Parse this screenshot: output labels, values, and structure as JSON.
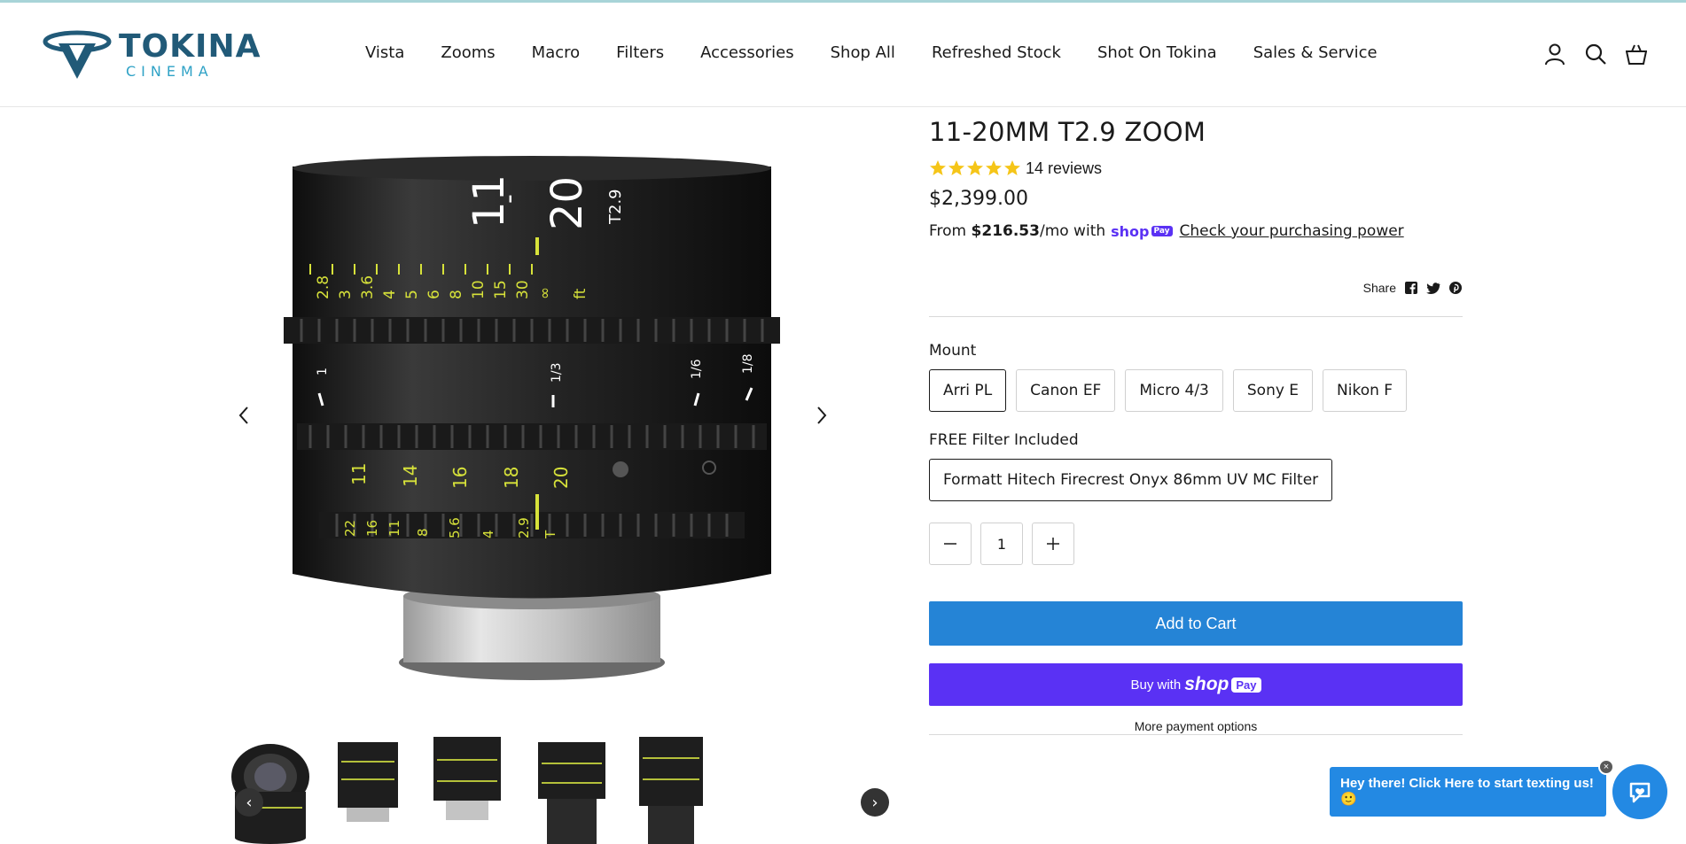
{
  "colors": {
    "brand_dark": "#215a78",
    "brand_light": "#2fa2c6",
    "add_to_cart": "#2584d6",
    "shop_pay": "#5a31f4",
    "chat": "#2389e3",
    "star": "#f5c518"
  },
  "brand": {
    "word": "TOKINA",
    "sub": "CINEMA"
  },
  "nav": {
    "items": [
      {
        "label": "Vista"
      },
      {
        "label": "Zooms"
      },
      {
        "label": "Macro"
      },
      {
        "label": "Filters"
      },
      {
        "label": "Accessories"
      },
      {
        "label": "Shop All"
      },
      {
        "label": "Refreshed Stock"
      },
      {
        "label": "Shot On Tokina"
      },
      {
        "label": "Sales & Service"
      }
    ]
  },
  "header_icons": [
    "account-icon",
    "search-icon",
    "cart-icon"
  ],
  "product": {
    "title": "11-20MM T2.9 ZOOM",
    "rating": 5,
    "reviews": "14 reviews",
    "price": "$2,399.00",
    "installment_prefix": "From",
    "installment_amount": "$216.53",
    "installment_suffix": "/mo with",
    "shop_pay_word": "shop",
    "shop_pay_badge": "Pay",
    "check_power": "Check your purchasing power",
    "share_label": "Share"
  },
  "lens_markings": {
    "focal_top": "11",
    "focal_bottom": "20",
    "aperture": "T2.9",
    "dash": "-",
    "distance": [
      "2.8",
      "3",
      "3.6",
      "4",
      "5",
      "6",
      "8",
      "10",
      "15",
      "30",
      "∞"
    ],
    "distance_unit": "ft",
    "zoom_scale": [
      "11",
      "14",
      "16",
      "18",
      "20"
    ],
    "iris_scale": [
      "22",
      "16",
      "11",
      "8",
      "5.6",
      "4",
      "2.9",
      "T"
    ],
    "fractions": [
      "1",
      "1/3",
      "1/6",
      "1/8"
    ]
  },
  "options": {
    "mount_label": "Mount",
    "mounts": [
      "Arri PL",
      "Canon EF",
      "Micro 4/3",
      "Sony E",
      "Nikon F"
    ],
    "mount_selected": "Arri PL",
    "filter_label": "FREE Filter Included",
    "filter_value": "Formatt Hitech Firecrest Onyx 86mm UV MC Filter"
  },
  "quantity": {
    "value": "1"
  },
  "buttons": {
    "add_to_cart": "Add to Cart",
    "buy_with": "Buy with",
    "shop_word": "shop",
    "pay_word": "Pay",
    "more_payment": "More payment options"
  },
  "gallery": {
    "thumb_prev": "‹",
    "thumb_next": "›"
  },
  "chat": {
    "message": "Hey there! Click Here to start texting us! 🙂",
    "close": "×"
  }
}
